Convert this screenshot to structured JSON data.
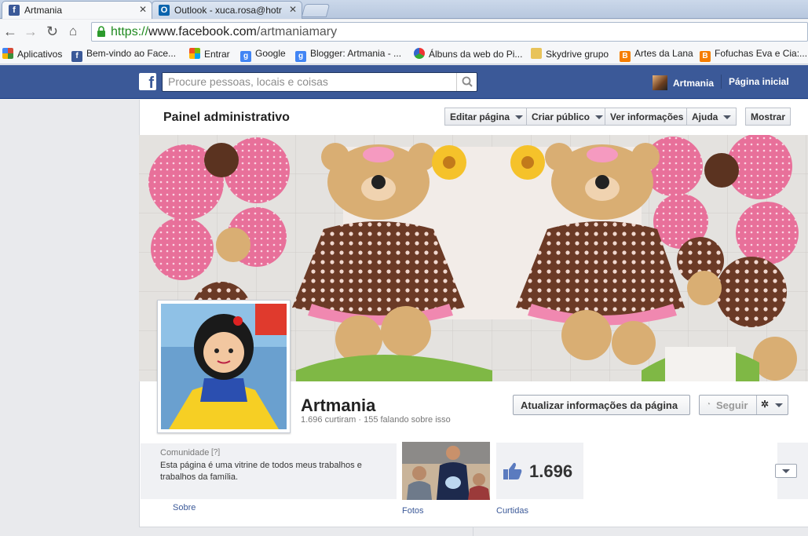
{
  "browser": {
    "tabs": [
      {
        "title": "Artmania",
        "icon": "facebook-icon",
        "active": true
      },
      {
        "title": "Outlook - xuca.rosa@hotr",
        "icon": "outlook-icon",
        "active": false
      }
    ],
    "url": {
      "protocol": "https://",
      "host": "www.facebook.com",
      "path": "/artmaniamary"
    },
    "bookmarks": [
      {
        "label": "Aplicativos",
        "icon": "apps-grid-icon",
        "color": "#d64937"
      },
      {
        "label": "Bem-vindo ao Face...",
        "icon": "facebook-icon",
        "color": "#3b5998"
      },
      {
        "label": "Entrar",
        "icon": "windows-icon",
        "color": "#f25022"
      },
      {
        "label": "Google",
        "icon": "google-icon",
        "color": "#4285f4"
      },
      {
        "label": "Blogger: Artmania - ...",
        "icon": "google-icon",
        "color": "#4285f4"
      },
      {
        "label": "Álbuns da web do Pi...",
        "icon": "picasa-icon",
        "color": "#d33"
      },
      {
        "label": "Skydrive grupo",
        "icon": "folder-icon",
        "color": "#e8c35a"
      },
      {
        "label": "Artes da Lana",
        "icon": "blogger-icon",
        "color": "#f57d00"
      },
      {
        "label": "Fofuchas Eva e Cia:...",
        "icon": "blogger-icon",
        "color": "#f57d00"
      }
    ]
  },
  "fb": {
    "search_placeholder": "Procure pessoas, locais e coisas",
    "user_name": "Artmania",
    "home_label": "Página inicial",
    "brand_color": "#3b5998"
  },
  "admin_panel": {
    "title": "Painel administrativo",
    "buttons": [
      "Editar página",
      "Criar público",
      "Ver informações",
      "Ajuda"
    ],
    "show_label": "Mostrar"
  },
  "page": {
    "name": "Artmania",
    "stats": "1.696 curtiram · 155 falando sobre isso",
    "update_button": "Atualizar informações da página",
    "follow_button": "Seguir"
  },
  "about": {
    "category": "Comunidade",
    "help": "[?]",
    "description_line1": "Esta página é uma vitrine de todos meus trabalhos e",
    "description_line2": "trabalhos da família.",
    "label": "Sobre"
  },
  "photos": {
    "label": "Fotos"
  },
  "likes": {
    "count": "1.696",
    "label": "Curtidas"
  }
}
